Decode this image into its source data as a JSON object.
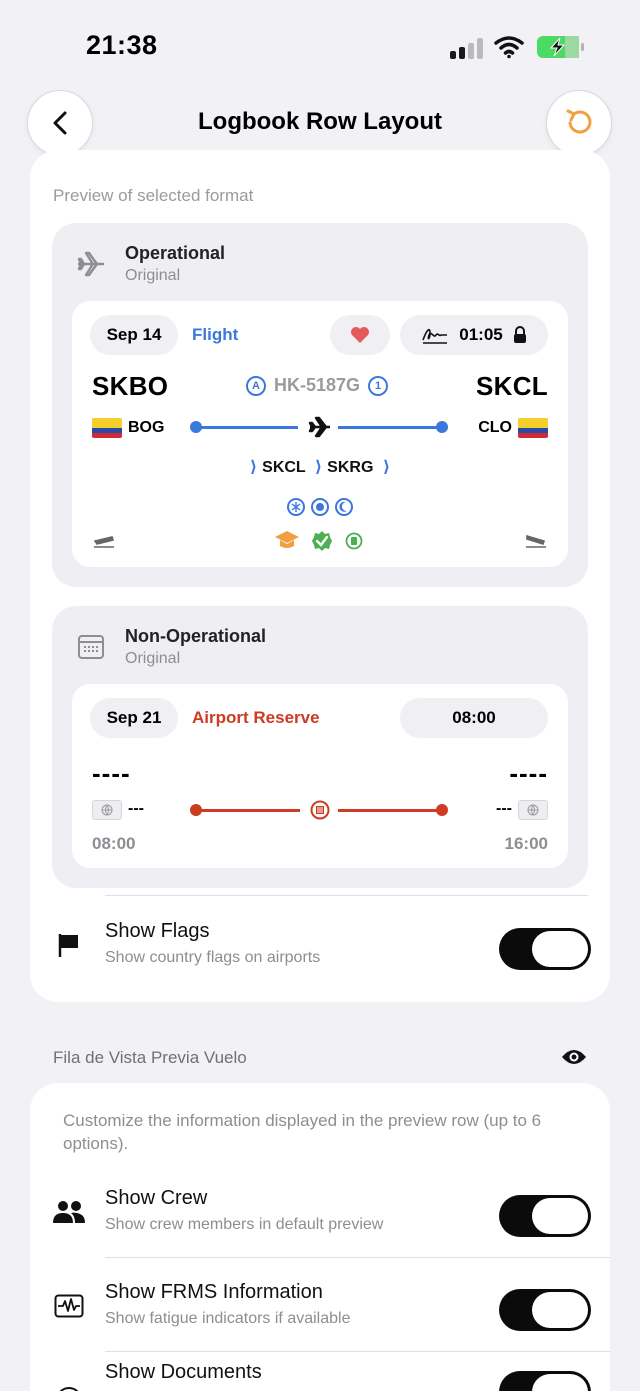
{
  "status_bar": {
    "time": "21:38"
  },
  "header": {
    "title": "Logbook Row Layout"
  },
  "preview": {
    "caption": "Preview of selected format",
    "operational": {
      "title": "Operational",
      "subtitle": "Original",
      "date": "Sep 14",
      "type": "Flight",
      "duration": "01:05",
      "origin_icao": "SKBO",
      "dest_icao": "SKCL",
      "tail_number": "HK-5187G",
      "tail_prefix_icon": "A",
      "tail_suffix_icon": "1",
      "origin_iata": "BOG",
      "dest_iata": "CLO",
      "via_1": "SKCL",
      "via_2": "SKRG",
      "accent_color": "#3b78dc"
    },
    "non_operational": {
      "title": "Non-Operational",
      "subtitle": "Original",
      "date": "Sep 21",
      "type": "Airport Reserve",
      "duration": "08:00",
      "origin_code": "----",
      "dest_code": "----",
      "origin_iata": "---",
      "dest_iata": "---",
      "start_time": "08:00",
      "end_time": "16:00",
      "accent_color": "#cc3b22"
    }
  },
  "settings": {
    "show_flags": {
      "title": "Show Flags",
      "desc": "Show country flags on airports",
      "enabled": true
    }
  },
  "preview_row_section": {
    "label": "Fila de Vista Previa Vuelo",
    "description": "Customize the information displayed in the preview row (up to 6 options).",
    "items": [
      {
        "title": "Show Crew",
        "desc": "Show crew members in default preview",
        "enabled": true
      },
      {
        "title": "Show FRMS Information",
        "desc": "Show fatigue indicators if available",
        "enabled": true
      },
      {
        "title": "Show Documents",
        "desc": "",
        "enabled": true
      }
    ]
  }
}
